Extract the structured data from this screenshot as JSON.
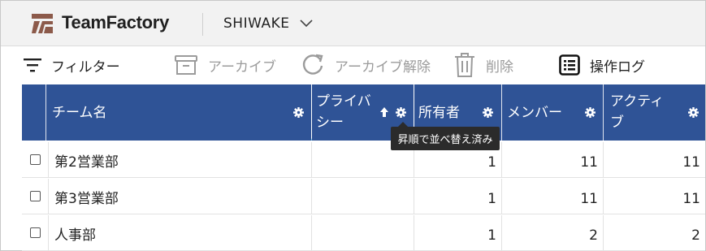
{
  "header": {
    "brand": "TeamFactory",
    "app_name": "SHIWAKE",
    "logo_icon": "teamfactory-logo-icon",
    "switch_icon": "chevron-down-icon",
    "colors": {
      "logo": "#8c5a4a",
      "header_bg": "#f2f2f2"
    }
  },
  "toolbar": {
    "filter": {
      "label": "フィルター",
      "icon": "filter-icon"
    },
    "archive": {
      "label": "アーカイブ",
      "icon": "archive-icon"
    },
    "unarchive": {
      "label": "アーカイブ解除",
      "icon": "refresh-icon"
    },
    "delete": {
      "label": "削除",
      "icon": "trash-icon"
    },
    "log": {
      "label": "操作ログ",
      "icon": "list-icon"
    }
  },
  "table": {
    "colors": {
      "header_bg": "#2f5396",
      "sort_indicator": "#35a6d9"
    },
    "columns": [
      {
        "label": "チーム名"
      },
      {
        "label_line1": "プライバ",
        "label_line2": "シー",
        "sorted": "ascending"
      },
      {
        "label": "所有者"
      },
      {
        "label": "メンバー"
      },
      {
        "label_line1": "アクティ",
        "label_line2": "ブ"
      }
    ],
    "rows": [
      {
        "name": "第2営業部",
        "privacy": "",
        "owners": "1",
        "members": "11",
        "active": "11"
      },
      {
        "name": "第3営業部",
        "privacy": "",
        "owners": "1",
        "members": "11",
        "active": "11"
      },
      {
        "name": "人事部",
        "privacy": "",
        "owners": "1",
        "members": "2",
        "active": "2"
      }
    ],
    "tooltip": "昇順で並べ替え済み"
  }
}
